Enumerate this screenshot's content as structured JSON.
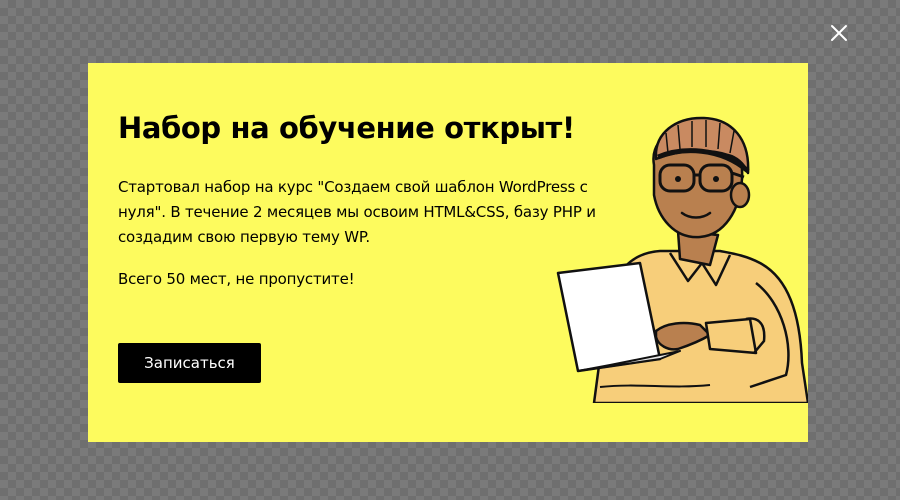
{
  "modal": {
    "title": "Набор на обучение открыт!",
    "description": "Стартовал набор на курс \"Создаем свой шаблон WordPress с нуля\". В течение 2 месяцев мы освоим HTML&CSS, базу PHP и создадим свою первую тему WP.",
    "note": "Всего 50 мест, не пропустите!",
    "cta_label": "Записаться",
    "background_color": "#fdfb5e"
  },
  "close": {
    "icon": "close-icon"
  },
  "illustration": {
    "icon": "person-with-laptop-illustration"
  }
}
